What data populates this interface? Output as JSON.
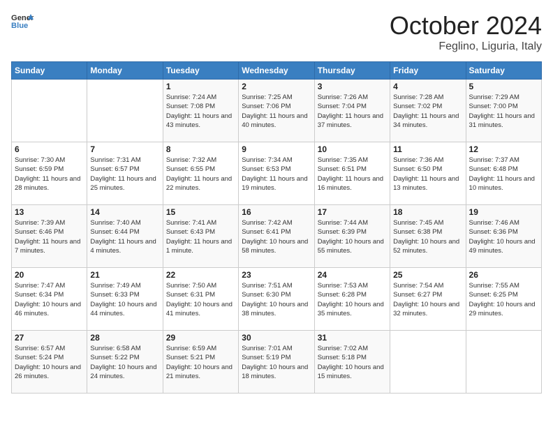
{
  "header": {
    "logo": {
      "general": "General",
      "blue": "Blue"
    },
    "title": "October 2024",
    "location": "Feglino, Liguria, Italy"
  },
  "days_of_week": [
    "Sunday",
    "Monday",
    "Tuesday",
    "Wednesday",
    "Thursday",
    "Friday",
    "Saturday"
  ],
  "weeks": [
    [
      null,
      null,
      {
        "day": 1,
        "sunrise": "7:24 AM",
        "sunset": "7:08 PM",
        "daylight": "11 hours and 43 minutes."
      },
      {
        "day": 2,
        "sunrise": "7:25 AM",
        "sunset": "7:06 PM",
        "daylight": "11 hours and 40 minutes."
      },
      {
        "day": 3,
        "sunrise": "7:26 AM",
        "sunset": "7:04 PM",
        "daylight": "11 hours and 37 minutes."
      },
      {
        "day": 4,
        "sunrise": "7:28 AM",
        "sunset": "7:02 PM",
        "daylight": "11 hours and 34 minutes."
      },
      {
        "day": 5,
        "sunrise": "7:29 AM",
        "sunset": "7:00 PM",
        "daylight": "11 hours and 31 minutes."
      }
    ],
    [
      {
        "day": 6,
        "sunrise": "7:30 AM",
        "sunset": "6:59 PM",
        "daylight": "11 hours and 28 minutes."
      },
      {
        "day": 7,
        "sunrise": "7:31 AM",
        "sunset": "6:57 PM",
        "daylight": "11 hours and 25 minutes."
      },
      {
        "day": 8,
        "sunrise": "7:32 AM",
        "sunset": "6:55 PM",
        "daylight": "11 hours and 22 minutes."
      },
      {
        "day": 9,
        "sunrise": "7:34 AM",
        "sunset": "6:53 PM",
        "daylight": "11 hours and 19 minutes."
      },
      {
        "day": 10,
        "sunrise": "7:35 AM",
        "sunset": "6:51 PM",
        "daylight": "11 hours and 16 minutes."
      },
      {
        "day": 11,
        "sunrise": "7:36 AM",
        "sunset": "6:50 PM",
        "daylight": "11 hours and 13 minutes."
      },
      {
        "day": 12,
        "sunrise": "7:37 AM",
        "sunset": "6:48 PM",
        "daylight": "11 hours and 10 minutes."
      }
    ],
    [
      {
        "day": 13,
        "sunrise": "7:39 AM",
        "sunset": "6:46 PM",
        "daylight": "11 hours and 7 minutes."
      },
      {
        "day": 14,
        "sunrise": "7:40 AM",
        "sunset": "6:44 PM",
        "daylight": "11 hours and 4 minutes."
      },
      {
        "day": 15,
        "sunrise": "7:41 AM",
        "sunset": "6:43 PM",
        "daylight": "11 hours and 1 minute."
      },
      {
        "day": 16,
        "sunrise": "7:42 AM",
        "sunset": "6:41 PM",
        "daylight": "10 hours and 58 minutes."
      },
      {
        "day": 17,
        "sunrise": "7:44 AM",
        "sunset": "6:39 PM",
        "daylight": "10 hours and 55 minutes."
      },
      {
        "day": 18,
        "sunrise": "7:45 AM",
        "sunset": "6:38 PM",
        "daylight": "10 hours and 52 minutes."
      },
      {
        "day": 19,
        "sunrise": "7:46 AM",
        "sunset": "6:36 PM",
        "daylight": "10 hours and 49 minutes."
      }
    ],
    [
      {
        "day": 20,
        "sunrise": "7:47 AM",
        "sunset": "6:34 PM",
        "daylight": "10 hours and 46 minutes."
      },
      {
        "day": 21,
        "sunrise": "7:49 AM",
        "sunset": "6:33 PM",
        "daylight": "10 hours and 44 minutes."
      },
      {
        "day": 22,
        "sunrise": "7:50 AM",
        "sunset": "6:31 PM",
        "daylight": "10 hours and 41 minutes."
      },
      {
        "day": 23,
        "sunrise": "7:51 AM",
        "sunset": "6:30 PM",
        "daylight": "10 hours and 38 minutes."
      },
      {
        "day": 24,
        "sunrise": "7:53 AM",
        "sunset": "6:28 PM",
        "daylight": "10 hours and 35 minutes."
      },
      {
        "day": 25,
        "sunrise": "7:54 AM",
        "sunset": "6:27 PM",
        "daylight": "10 hours and 32 minutes."
      },
      {
        "day": 26,
        "sunrise": "7:55 AM",
        "sunset": "6:25 PM",
        "daylight": "10 hours and 29 minutes."
      }
    ],
    [
      {
        "day": 27,
        "sunrise": "6:57 AM",
        "sunset": "5:24 PM",
        "daylight": "10 hours and 26 minutes."
      },
      {
        "day": 28,
        "sunrise": "6:58 AM",
        "sunset": "5:22 PM",
        "daylight": "10 hours and 24 minutes."
      },
      {
        "day": 29,
        "sunrise": "6:59 AM",
        "sunset": "5:21 PM",
        "daylight": "10 hours and 21 minutes."
      },
      {
        "day": 30,
        "sunrise": "7:01 AM",
        "sunset": "5:19 PM",
        "daylight": "10 hours and 18 minutes."
      },
      {
        "day": 31,
        "sunrise": "7:02 AM",
        "sunset": "5:18 PM",
        "daylight": "10 hours and 15 minutes."
      },
      null,
      null
    ]
  ]
}
